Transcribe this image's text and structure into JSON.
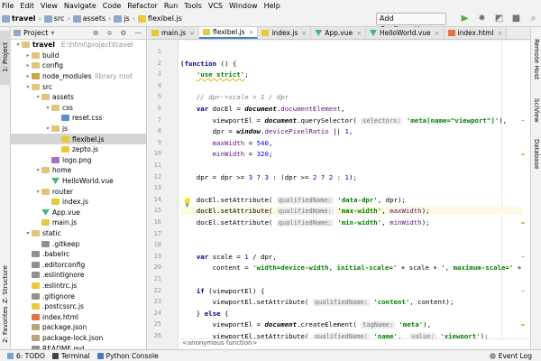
{
  "menu": [
    "File",
    "Edit",
    "View",
    "Navigate",
    "Code",
    "Refactor",
    "Run",
    "Tools",
    "VCS",
    "Window",
    "Help"
  ],
  "nav": {
    "breadcrumbs": [
      "travel",
      "src",
      "assets",
      "js",
      "flexibel.js"
    ],
    "add_config": "Add Configuration..."
  },
  "left_tabs": {
    "project": "1: Project",
    "structure": "Z: Structure",
    "favorites": "2: Favorites"
  },
  "right_tabs": {
    "remote": "Remote Host",
    "sciview": "SciView",
    "database": "Database"
  },
  "project": {
    "title": "Project",
    "tree": [
      {
        "indent": 0,
        "arrow": "▾",
        "icon": "folder",
        "label": "travel",
        "extra": "E:\\html\\project\\travel",
        "bold": true
      },
      {
        "indent": 1,
        "arrow": "▸",
        "icon": "folder",
        "label": "build"
      },
      {
        "indent": 1,
        "arrow": "▸",
        "icon": "folder",
        "label": "config"
      },
      {
        "indent": 1,
        "arrow": "▸",
        "icon": "mod",
        "label": "node_modules",
        "extra": "library root"
      },
      {
        "indent": 1,
        "arrow": "▾",
        "icon": "folder",
        "label": "src"
      },
      {
        "indent": 2,
        "arrow": "▾",
        "icon": "folder",
        "label": "assets"
      },
      {
        "indent": 3,
        "arrow": "▾",
        "icon": "folder",
        "label": "css"
      },
      {
        "indent": 4,
        "arrow": "",
        "icon": "css",
        "label": "reset.css"
      },
      {
        "indent": 3,
        "arrow": "▾",
        "icon": "folder",
        "label": "js"
      },
      {
        "indent": 4,
        "arrow": "",
        "icon": "js",
        "label": "flexibel.js",
        "selected": true
      },
      {
        "indent": 4,
        "arrow": "",
        "icon": "js",
        "label": "zepto.js"
      },
      {
        "indent": 3,
        "arrow": "",
        "icon": "png",
        "label": "logo.png"
      },
      {
        "indent": 2,
        "arrow": "▾",
        "icon": "folder",
        "label": "home"
      },
      {
        "indent": 3,
        "arrow": "",
        "icon": "vue",
        "label": "HelloWorld.vue"
      },
      {
        "indent": 2,
        "arrow": "▾",
        "icon": "folder",
        "label": "router"
      },
      {
        "indent": 3,
        "arrow": "",
        "icon": "js",
        "label": "index.js"
      },
      {
        "indent": 2,
        "arrow": "",
        "icon": "vue",
        "label": "App.vue"
      },
      {
        "indent": 2,
        "arrow": "",
        "icon": "js",
        "label": "main.js"
      },
      {
        "indent": 1,
        "arrow": "▾",
        "icon": "folder",
        "label": "static"
      },
      {
        "indent": 2,
        "arrow": "",
        "icon": "cfg",
        "label": ".gitkeep"
      },
      {
        "indent": 1,
        "arrow": "",
        "icon": "cfg",
        "label": ".babelrc"
      },
      {
        "indent": 1,
        "arrow": "",
        "icon": "cfg",
        "label": ".editorconfig"
      },
      {
        "indent": 1,
        "arrow": "",
        "icon": "cfg",
        "label": ".eslintignore"
      },
      {
        "indent": 1,
        "arrow": "",
        "icon": "js",
        "label": ".eslintrc.js"
      },
      {
        "indent": 1,
        "arrow": "",
        "icon": "cfg",
        "label": ".gitignore"
      },
      {
        "indent": 1,
        "arrow": "",
        "icon": "js",
        "label": ".postcssrc.js"
      },
      {
        "indent": 1,
        "arrow": "",
        "icon": "html",
        "label": "index.html"
      },
      {
        "indent": 1,
        "arrow": "",
        "icon": "json",
        "label": "package.json"
      },
      {
        "indent": 1,
        "arrow": "",
        "icon": "json",
        "label": "package-lock.json"
      },
      {
        "indent": 1,
        "arrow": "",
        "icon": "cfg",
        "label": "README.md"
      }
    ]
  },
  "tabs": [
    {
      "label": "main.js",
      "icon": "js"
    },
    {
      "label": "flexibel.js",
      "icon": "js",
      "active": true
    },
    {
      "label": "index.js",
      "icon": "js"
    },
    {
      "label": "App.vue",
      "icon": "vue"
    },
    {
      "label": "HelloWorld.vue",
      "icon": "vue"
    },
    {
      "label": "index.html",
      "icon": "html"
    }
  ],
  "code_lines": [
    {
      "n": "1",
      "html": ""
    },
    {
      "n": "2",
      "html": "<span class='kw'>(function</span> () {"
    },
    {
      "n": "3",
      "html": "    <span class='str sq'>'use strict'</span>;"
    },
    {
      "n": "4",
      "html": ""
    },
    {
      "n": "5",
      "html": "    <span class='cm'>// dpr->scale = 1 / dpr</span>"
    },
    {
      "n": "6",
      "html": "    <span class='kw'>var</span> docEl = <span class='fn'><b>document</b></span>.<span class='prop'>documentElement</span>,"
    },
    {
      "n": "7",
      "html": "        viewportEl = <span class='fn'><b>document</b></span>.querySelector( <span class='hint'>selectors:</span> <span class='str'>'meta[name=\"viewport\"]'</span>),"
    },
    {
      "n": "8",
      "html": "        dpr = <span class='fn'><b>window</b></span>.<span class='prop'>devicePixelRatio</span> || <span class='num'>1</span>,"
    },
    {
      "n": "9",
      "html": "        <span class='prop'>maxWidth</span> = <span class='num'>540</span>,"
    },
    {
      "n": "10",
      "html": "        <span class='prop'>minWidth</span> = <span class='num'>320</span>;"
    },
    {
      "n": "11",
      "html": ""
    },
    {
      "n": "12",
      "html": "    dpr = dpr >= <span class='num'>3</span> ? <span class='num'>3</span> : (dpr >= <span class='num'>2</span> ? <span class='num'>2</span> : <span class='num'>1</span>);"
    },
    {
      "n": "13",
      "html": ""
    },
    {
      "n": "14",
      "html": "    docEl.setAttribute( <span class='hint'>qualifiedName:</span> <span class='str'>'data-dpr'</span>, dpr);"
    },
    {
      "n": "15",
      "html": "    docEl.setAttribute( <span class='hint'>qualifiedName:</span> <span class='str'>'max-width'</span>, <span class='prop'>maxWidth</span>);",
      "hl": true
    },
    {
      "n": "16",
      "html": "    docEl.setAttribute( <span class='hint'>qualifiedName:</span> <span class='str'>'min-width'</span>, <span class='prop'>minWidth</span>);"
    },
    {
      "n": "17",
      "html": ""
    },
    {
      "n": "18",
      "html": ""
    },
    {
      "n": "19",
      "html": "    <span class='kw'>var</span> scale = <span class='num'>1</span> / dpr,"
    },
    {
      "n": "20",
      "html": "        content = <span class='str'>'width=device-width, initial-scale='</span> + scale + <span class='str'>', maximum-scale='</span> + sc"
    },
    {
      "n": "21",
      "html": ""
    },
    {
      "n": "22",
      "html": "    <span class='kw'>if</span> (viewportEl) {"
    },
    {
      "n": "23",
      "html": "        viewportEl.setAttribute( <span class='hint'>qualifiedName:</span> <span class='str'>'content'</span>, content);"
    },
    {
      "n": "24",
      "html": "    } <span class='kw'>else</span> {"
    },
    {
      "n": "25",
      "html": "        viewportEl = <span class='fn'><b>document</b></span>.createElement( <span class='hint'>tagName:</span> <span class='str'>'meta'</span>),"
    },
    {
      "n": "26",
      "html": "        viewportEl.setAttribute( <span class='hint'>qualifiedName:</span> <span class='str'>'name'</span>,  <span class='hint'>value:</span> <span class='str'>'viewport'</span>);"
    }
  ],
  "editor_breadcrumb": "<anonymous function>",
  "status": {
    "todo": "6: TODO",
    "terminal": "Terminal",
    "python": "Python Console",
    "event": "Event Log"
  }
}
